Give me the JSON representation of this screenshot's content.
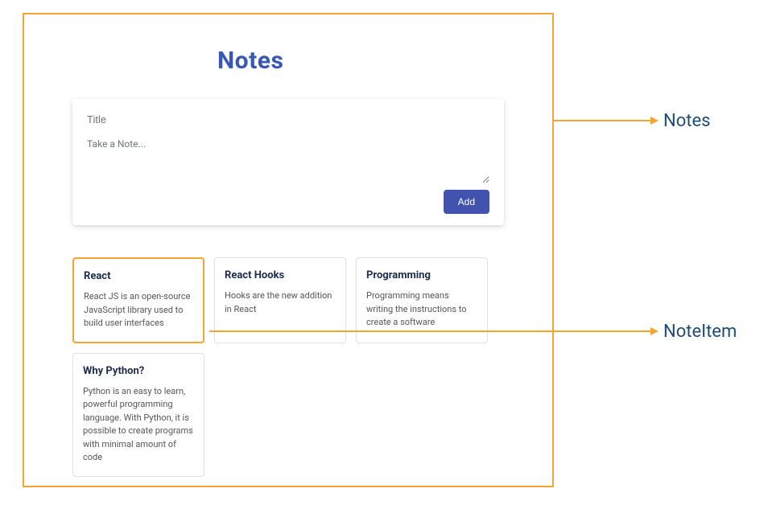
{
  "page": {
    "title": "Notes"
  },
  "compose": {
    "title_placeholder": "Title",
    "body_placeholder": "Take a Note...",
    "add_button_label": "Add"
  },
  "notes": [
    {
      "title": "React",
      "body": "React JS is an open-source JavaScript library used to build user interfaces",
      "highlighted": true
    },
    {
      "title": "React Hooks",
      "body": "Hooks are the new addition in React",
      "highlighted": false
    },
    {
      "title": "Programming",
      "body": "Programming means writing the instructions to create a software",
      "highlighted": false
    },
    {
      "title": "Why Python?",
      "body": "Python is an easy to learn, powerful programming language. With Python, it is possible to create programs with minimal amount of code",
      "highlighted": false
    }
  ],
  "annotations": {
    "notes_label": "Notes",
    "noteitem_label": "NoteItem",
    "arrow_color": "#F7A432",
    "label_color": "#1d4d75"
  }
}
